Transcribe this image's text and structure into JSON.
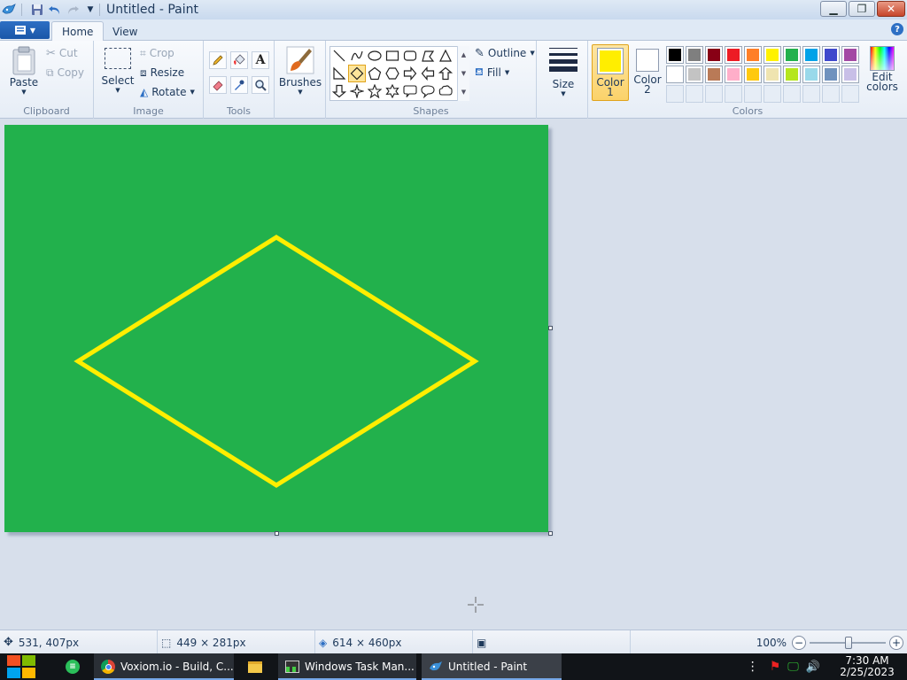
{
  "window": {
    "title": "Untitled - Paint"
  },
  "tabs": {
    "home": "Home",
    "view": "View"
  },
  "clipboard": {
    "paste": "Paste",
    "cut": "Cut",
    "copy": "Copy",
    "label": "Clipboard"
  },
  "image": {
    "select": "Select",
    "crop": "Crop",
    "resize": "Resize",
    "rotate": "Rotate",
    "label": "Image"
  },
  "tools": {
    "label": "Tools"
  },
  "brushes": {
    "label": "Brushes"
  },
  "shapes": {
    "outline": "Outline",
    "fill": "Fill",
    "label": "Shapes"
  },
  "size": {
    "label": "Size"
  },
  "colors": {
    "color1": "Color",
    "color1_num": "1",
    "color2": "Color",
    "color2_num": "2",
    "edit": "Edit",
    "edit2": "colors",
    "label": "Colors",
    "color1_value": "#ffee00",
    "color2_value": "#ffffff",
    "row1": [
      "#000000",
      "#7f7f7f",
      "#880015",
      "#ed1c24",
      "#ff7f27",
      "#fff200",
      "#22b14c",
      "#00a2e8",
      "#3f48cc",
      "#a349a4"
    ],
    "row2": [
      "#ffffff",
      "#c3c3c3",
      "#b97a57",
      "#ffaec9",
      "#ffc90e",
      "#efe4b0",
      "#b5e61d",
      "#99d9ea",
      "#7092be",
      "#c8bfe7"
    ]
  },
  "canvas": {
    "background": "#22b14c",
    "shape_stroke": "#ffee00",
    "shape": "diamond"
  },
  "status": {
    "cursor_pos": "531, 407px",
    "selection_size": "449 × 281px",
    "image_size": "614 × 460px",
    "zoom": "100%"
  },
  "taskbar": {
    "chrome": "Voxiom.io - Build, C...",
    "taskman": "Windows Task Man...",
    "paint": "Untitled - Paint",
    "time": "7:30 AM",
    "date": "2/25/2023"
  }
}
